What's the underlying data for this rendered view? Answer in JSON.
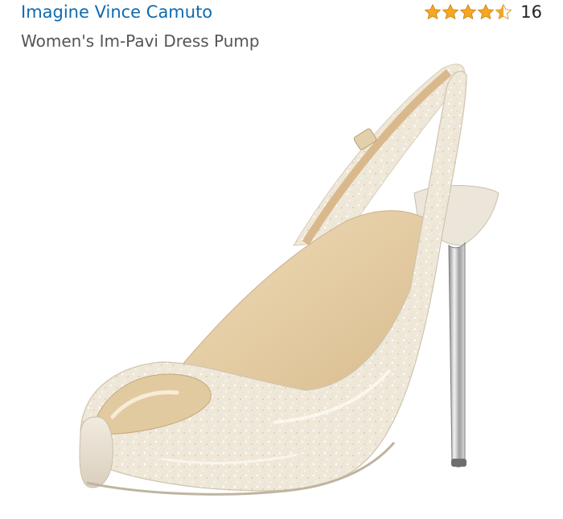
{
  "product": {
    "brand": "Imagine Vince Camuto",
    "title": "Women's Im-Pavi Dress Pump",
    "rating": {
      "stars": 4.5,
      "max_stars": 5,
      "review_count": "16",
      "star_color": "#f5a623"
    },
    "image": {
      "icon": "product-shoe-image",
      "colors": {
        "glitter_upper": "#efe8d6",
        "inner_lining": "#e6cfa6",
        "heel_metal": "#b9b9b9",
        "platform": "#e8e1d2"
      }
    }
  }
}
